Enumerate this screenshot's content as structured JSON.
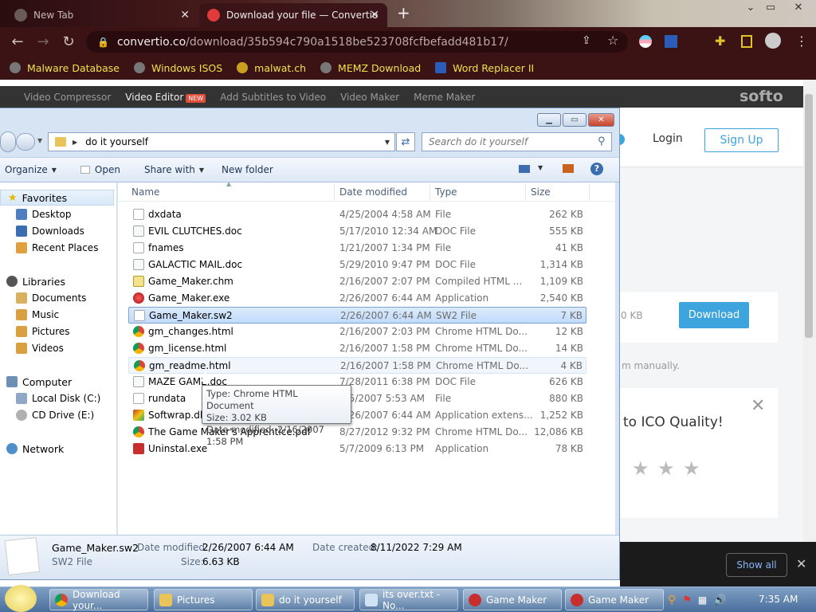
{
  "browser": {
    "tabs": [
      {
        "title": "New Tab"
      },
      {
        "title": "Download your file — Convertio"
      }
    ],
    "url_host": "convertio.co",
    "url_path": "/download/35b594c790a1518be523708fcfbefadd481b17/",
    "bookmarks": [
      {
        "label": "Malware Database"
      },
      {
        "label": "Windows ISOS"
      },
      {
        "label": "malwat.ch"
      },
      {
        "label": "MEMZ Download"
      },
      {
        "label": "Word Replacer II"
      }
    ]
  },
  "webpage": {
    "nav": [
      "Video Compressor",
      "Video Editor",
      "Add Subtitles to Video",
      "Video Maker",
      "Meme Maker"
    ],
    "new_badge": "NEW",
    "brand": "softo",
    "login": "Login",
    "signup": "Sign Up",
    "download_size": "0 KB",
    "download_button": "Download",
    "manually_text": "m manually.",
    "ico_title": "to ICO Quality!",
    "stars": [
      "★",
      "★",
      "★"
    ],
    "show_all": "Show all"
  },
  "explorer": {
    "address": "do it yourself",
    "search_placeholder": "Search do it yourself",
    "commands": {
      "organize": "Organize",
      "open": "Open",
      "share": "Share with",
      "newfolder": "New folder"
    },
    "nav": {
      "favorites": "Favorites",
      "desktop": "Desktop",
      "downloads": "Downloads",
      "recent": "Recent Places",
      "libraries": "Libraries",
      "documents": "Documents",
      "music": "Music",
      "pictures": "Pictures",
      "videos": "Videos",
      "computer": "Computer",
      "localdisk": "Local Disk (C:)",
      "cddrive": "CD Drive (E:)",
      "network": "Network"
    },
    "columns": {
      "name": "Name",
      "date": "Date modified",
      "type": "Type",
      "size": "Size"
    },
    "files": [
      {
        "name": "dxdata",
        "date": "4/25/2004 4:58 AM",
        "type": "File",
        "size": "262 KB",
        "icon": "file"
      },
      {
        "name": "EVIL CLUTCHES.doc",
        "date": "5/17/2010 12:34 AM",
        "type": "DOC File",
        "size": "555 KB",
        "icon": "doc"
      },
      {
        "name": "fnames",
        "date": "1/21/2007 1:34 PM",
        "type": "File",
        "size": "41 KB",
        "icon": "file"
      },
      {
        "name": "GALACTIC MAIL.doc",
        "date": "5/29/2010 9:47 PM",
        "type": "DOC File",
        "size": "1,314 KB",
        "icon": "doc"
      },
      {
        "name": "Game_Maker.chm",
        "date": "2/16/2007 2:07 PM",
        "type": "Compiled HTML ...",
        "size": "1,109 KB",
        "icon": "chm"
      },
      {
        "name": "Game_Maker.exe",
        "date": "2/26/2007 6:44 AM",
        "type": "Application",
        "size": "2,540 KB",
        "icon": "exe"
      },
      {
        "name": "Game_Maker.sw2",
        "date": "2/26/2007 6:44 AM",
        "type": "SW2 File",
        "size": "7 KB",
        "icon": "file"
      },
      {
        "name": "gm_changes.html",
        "date": "2/16/2007 2:03 PM",
        "type": "Chrome HTML Do...",
        "size": "12 KB",
        "icon": "chrome"
      },
      {
        "name": "gm_license.html",
        "date": "2/16/2007 1:58 PM",
        "type": "Chrome HTML Do...",
        "size": "14 KB",
        "icon": "chrome"
      },
      {
        "name": "gm_readme.html",
        "date": "2/16/2007 1:58 PM",
        "type": "Chrome HTML Do...",
        "size": "4 KB",
        "icon": "chrome"
      },
      {
        "name": "MAZE GAME.doc",
        "date": "7/28/2011 6:38 PM",
        "type": "DOC File",
        "size": "626 KB",
        "icon": "doc"
      },
      {
        "name": "rundata",
        "date": "6/5/2007 5:53 AM",
        "type": "File",
        "size": "880 KB",
        "icon": "file"
      },
      {
        "name": "Softwrap.dll",
        "date": "2/26/2007 6:44 AM",
        "type": "Application extens...",
        "size": "1,252 KB",
        "icon": "dll"
      },
      {
        "name": "The Game Maker's Apprentice.pdf",
        "date": "8/27/2012 9:32 PM",
        "type": "Chrome HTML Do...",
        "size": "12,086 KB",
        "icon": "chrome"
      },
      {
        "name": "Uninstal.exe",
        "date": "5/7/2009 6:13 PM",
        "type": "Application",
        "size": "78 KB",
        "icon": "uninst"
      }
    ],
    "tooltip": {
      "type": "Type: Chrome HTML Document",
      "size": "Size: 3.02 KB",
      "date": "Date modified: 2/16/2007 1:58 PM"
    },
    "details": {
      "name": "Game_Maker.sw2",
      "kind": "SW2 File",
      "date_modified_label": "Date modified:",
      "date_modified": "2/26/2007 6:44 AM",
      "date_created_label": "Date created:",
      "date_created": "8/11/2022 7:29 AM",
      "size_label": "Size:",
      "size": "6.63 KB"
    }
  },
  "taskbar": {
    "items": [
      {
        "label": "Download your..."
      },
      {
        "label": "Pictures"
      },
      {
        "label": "do it yourself"
      },
      {
        "label": "its over.txt - No..."
      },
      {
        "label": "Game Maker"
      },
      {
        "label": "Game Maker"
      }
    ],
    "clock": "7:35 AM"
  }
}
